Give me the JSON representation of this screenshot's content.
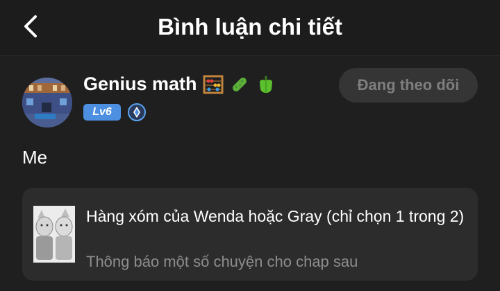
{
  "header": {
    "title": "Bình luận chi tiết",
    "back_icon": "chevron-left-icon"
  },
  "author": {
    "name": "Genius math",
    "emojis": [
      "abacus-emoji",
      "cucumber-emoji",
      "bell-pepper-emoji"
    ],
    "level": "Lv6",
    "rank_icon": "diamond-badge-icon",
    "follow_label": "Đang theo dõi"
  },
  "comment": {
    "text": "Me"
  },
  "linked_post": {
    "title": "Hàng xóm của Wenda hoặc Gray (chỉ chọn 1 trong 2)",
    "subtitle": "Thông báo một số chuyện cho chap sau"
  },
  "colors": {
    "background": "#1f1f1f",
    "card": "#2c2c2c",
    "level_badge": "#4d8fe0",
    "follow_button": "#353535"
  }
}
